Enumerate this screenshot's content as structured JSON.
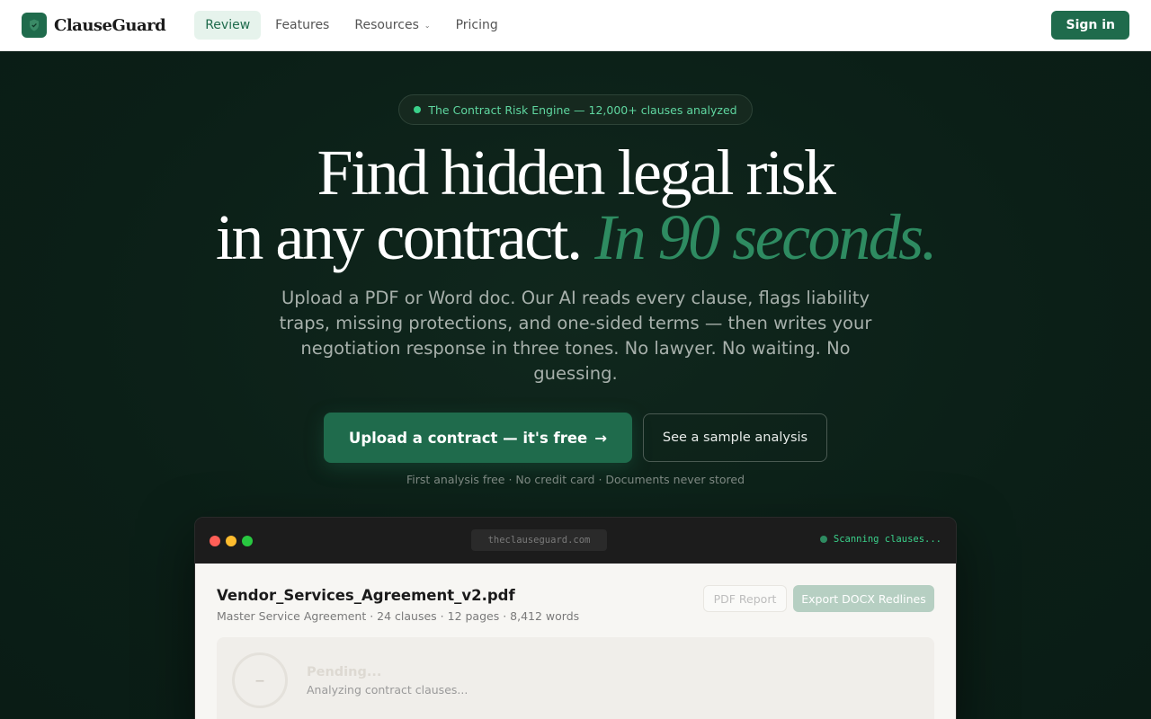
{
  "nav": {
    "brand": "ClauseGuard",
    "logo_icon": "shield-check-icon",
    "links": [
      {
        "label": "Review",
        "active": true
      },
      {
        "label": "Features",
        "active": false
      },
      {
        "label": "Resources",
        "active": false,
        "has_dropdown": true
      },
      {
        "label": "Pricing",
        "active": false
      }
    ],
    "signin_label": "Sign in"
  },
  "hero": {
    "badge": "The Contract Risk Engine — 12,000+ clauses analyzed",
    "headline_line1": "Find hidden legal risk",
    "headline_line2": "in any contract.",
    "headline_accent": "In 90 seconds.",
    "subtitle": "Upload a PDF or Word doc. Our AI reads every clause, flags liability traps, missing protections, and one-sided terms — then writes your negotiation response in three tones. No lawyer. No waiting. No guessing.",
    "primary_cta": "Upload a contract — it's free",
    "primary_cta_arrow": "→",
    "secondary_cta": "See a sample analysis",
    "fineprint": "First analysis free · No credit card · Documents never stored"
  },
  "preview": {
    "url": "theclauseguard.com",
    "status": "Scanning clauses...",
    "file_name": "Vendor_Services_Agreement_v2.pdf",
    "file_meta": "Master Service Agreement · 24 clauses · 12 pages · 8,412 words",
    "pdf_button": "PDF Report",
    "docx_button": "Export DOCX Redlines",
    "pending_score": "–",
    "pending_title": "Pending...",
    "pending_sub": "Analyzing contract clauses..."
  },
  "colors": {
    "brand_green": "#1f6b4c",
    "accent_green": "#2e8b61",
    "hero_bg": "#0b1f17"
  }
}
